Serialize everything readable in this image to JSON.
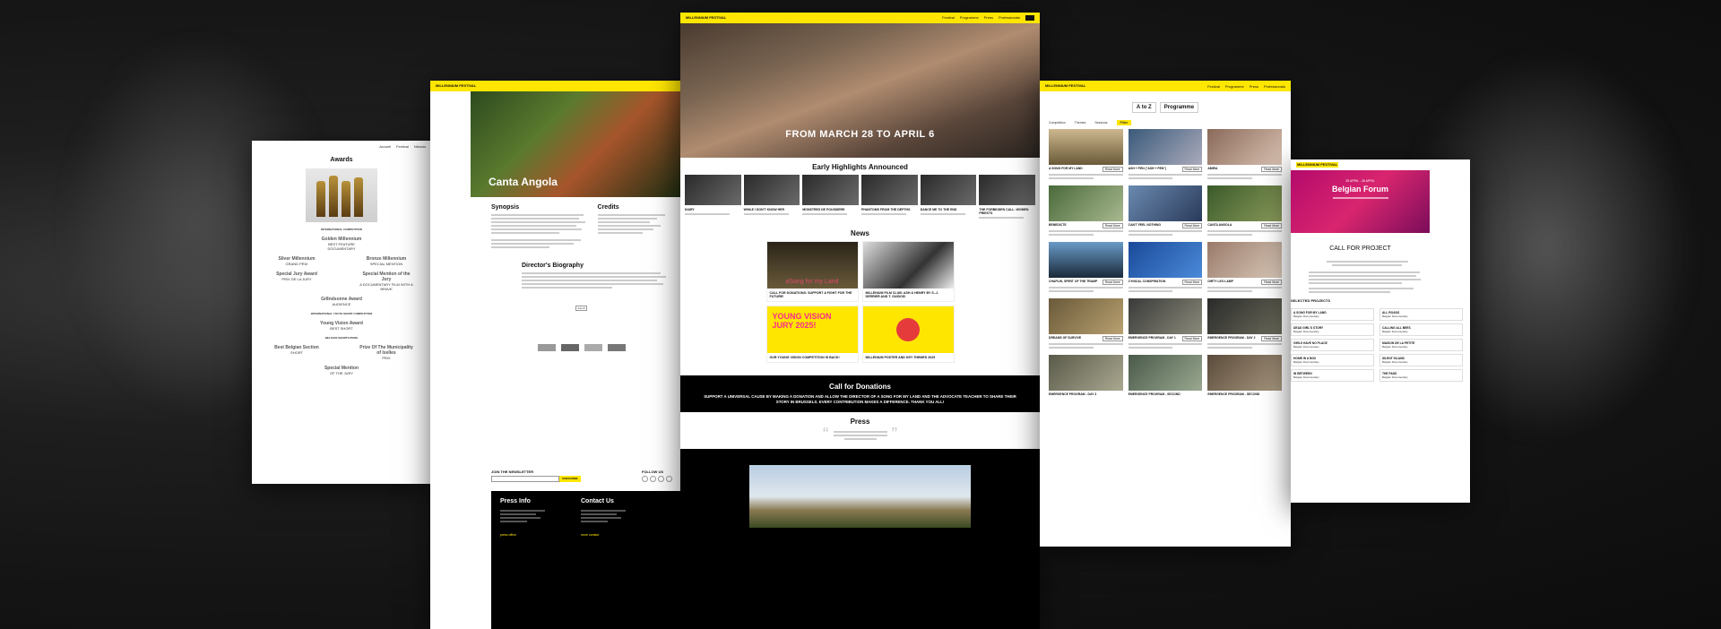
{
  "awards": {
    "title": "Awards",
    "nav": [
      "Accueil",
      "Festival",
      "Nieuws"
    ],
    "category_international": "INTERNATIONAL COMPETITION",
    "category_youth": "INTERNATIONAL YOUTH SHORT COMPETITION",
    "category_belgian": "BELGIAN SHORTS PRIZE",
    "items": [
      {
        "name": "Golden Millennium",
        "sub": "BEST FEATURE DOCUMENTARY"
      },
      {
        "name": "Silver Millennium",
        "sub": "GRAND PRIX"
      },
      {
        "name": "Bronze Millennium",
        "sub": "SPECIAL MENTION"
      },
      {
        "name": "Special Jury Award",
        "sub": "PRIX DE LA JURY"
      },
      {
        "name": "Special Mention of the Jury",
        "sub": "A DOCUMENTARY FILM WITH A BRAVE"
      },
      {
        "name": "Gr8ndsonne Award",
        "sub": "AUDIENCE"
      },
      {
        "name": "Young Vision Award",
        "sub": "BEST SHORT"
      },
      {
        "name": "Best Belgian Section",
        "sub": "SHORT"
      },
      {
        "name": "Prize Of The Municipality of Ixelles",
        "sub": "PRIX"
      },
      {
        "name": "Special Mention",
        "sub": "OF THE JURY"
      }
    ]
  },
  "film_page": {
    "hero_title": "Canta Angola",
    "synopsis_title": "Synopsis",
    "credits_title": "Credits",
    "biography_title": "Director's Biography",
    "back_label": "A to Z",
    "newsletter_label": "JOIN THE NEWSLETTER",
    "subscribe_label": "SUBSCRIBE",
    "follow_label": "FOLLOW US",
    "press_title": "Press Info",
    "contact_title": "Contact Us",
    "press_link": "press office",
    "contact_link": "more contact"
  },
  "home": {
    "logo": "MILLENNIUM FESTIVAL",
    "nav": [
      "Festival",
      "Programme",
      "Press",
      "Professionals"
    ],
    "hero_title": "FROM MARCH 28 TO APRIL 6",
    "highlights_title": "Early Highlights Announced",
    "highlights": [
      {
        "name": "DIARY"
      },
      {
        "name": "WHILE I DON'T KNOW HER"
      },
      {
        "name": "MONSTRES DE POUSSIERE"
      },
      {
        "name": "PHANTOMS FROM THE DEPTHS"
      },
      {
        "name": "DANCE ME TO THE END"
      },
      {
        "name": "THE FORBIDDEN CALL: WOMEN PRIESTS"
      }
    ],
    "news_title": "News",
    "news": [
      {
        "title": "CALL FOR DONATIONS: SUPPORT A FIGHT FOR THE FUTURE!",
        "img_text": "aSong for my Land"
      },
      {
        "title": "MILLENIUM FILM CLUB: ASH & HENRY BY S.-J. DERRIER AND T. GUIDOS!",
        "img_text": ""
      },
      {
        "title": "OUR YOUNG VISION COMPETITION IS BACK!",
        "img_text": "YOUNG VISION JURY 2025!"
      },
      {
        "title": "MILLENIUM POSTER AND KEY THEMES 2025",
        "img_text": ""
      }
    ],
    "donation_title": "Call for Donations",
    "donation_text": "SUPPORT A UNIVERSAL CAUSE BY MAKING A DONATION AND ALLOW THE DIRECTOR OF A SONG FOR MY LAND AND THE ADVOCATE TEACHER TO SHARE THEIR STORY IN BRUSSELS. EVERY CONTRIBUTION MAKES A DIFFERENCE. THANK YOU ALL!",
    "press_title": "Press"
  },
  "programme": {
    "tabs": [
      "A to Z",
      "Programme"
    ],
    "filters": [
      "Competition",
      "Themes",
      "Sessions"
    ],
    "filter_button": "Filter",
    "films": [
      {
        "name": "A SONG FOR MY LAND"
      },
      {
        "name": "ASH + PEN (\"ASH + PEN\")"
      },
      {
        "name": "AMIRA"
      },
      {
        "name": "BENEDICTE"
      },
      {
        "name": "CAN'T FEEL NOTHING"
      },
      {
        "name": "CANTA ANGOLA"
      },
      {
        "name": "CHAPLIN, SPIRIT OF THE TRAMP"
      },
      {
        "name": "CYNICAL CONSPIRATION"
      },
      {
        "name": "DIRTY LEO LAMP"
      },
      {
        "name": "DREAMS OF SURVIVE"
      },
      {
        "name": "EMERGENCE PROGRAM - DAY 1"
      },
      {
        "name": "EMERGENCE PROGRAM - DAY 2"
      },
      {
        "name": "EMERGENCE PROGRAM - DAY 3"
      },
      {
        "name": "EMERGENCE PROGRAM - SECOND"
      },
      {
        "name": "EMERGENCE PROGRAM - SECOND"
      }
    ],
    "more_label": "Read More"
  },
  "forum": {
    "dates": "25 APRIL - 26 APRIL",
    "title": "Belgian Forum",
    "cfp_title": "CALL FOR PROJECT",
    "projects_title": "SELECTED PROJECTS",
    "projects": [
      {
        "name": "A SONG FOR MY LAND",
        "sub": "Belgian Documentary"
      },
      {
        "name": "ALL ROADS",
        "sub": "Belgian Documentary"
      },
      {
        "name": "DEAD GIRL'S STORY",
        "sub": "Belgian Documentary"
      },
      {
        "name": "CALLING ALL BEES",
        "sub": "Belgian Documentary"
      },
      {
        "name": "GIRLS HAVE NO PLACE",
        "sub": "Belgian Documentary"
      },
      {
        "name": "MAISON DE LA PETITE",
        "sub": "Belgian Documentary"
      },
      {
        "name": "HOME IN A BOX",
        "sub": "Belgian Documentary"
      },
      {
        "name": "SILENT ISLAND",
        "sub": "Belgian Documentary"
      },
      {
        "name": "IN BETWEEN",
        "sub": "Belgian Documentary"
      },
      {
        "name": "THE PASS",
        "sub": "Belgian Documentary"
      }
    ]
  }
}
